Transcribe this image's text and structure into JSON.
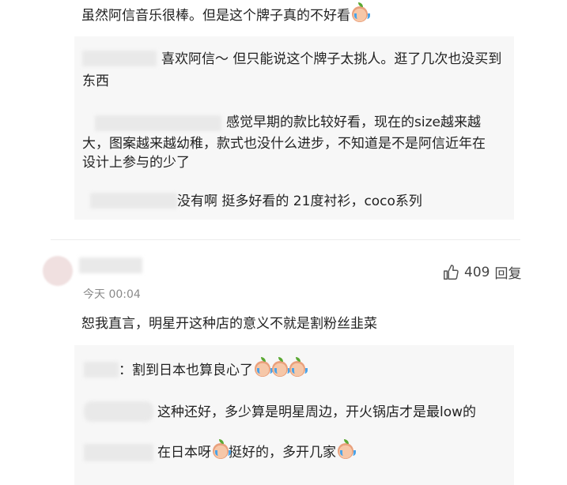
{
  "comment_1": {
    "text": "虽然阿信音乐很棒。但是这个牌子真的不好看",
    "emoji": "crying-emoji",
    "replies": [
      {
        "text_line1": "喜欢阿信～ 但只能说这个牌子太挑人。逛了几次也没买到",
        "text_line2": "东西"
      },
      {
        "text_line1": "感觉早期的款比较好看，现在的size越来越",
        "text_line2": "大，图案越来越幼稚，款式也没什么进步，不知道是不是阿信近年在",
        "text_line3": "设计上参与的少了"
      },
      {
        "text": "没有啊 挺多好看的 21度衬衫，coco系列"
      }
    ]
  },
  "comment_2": {
    "time": "今天 00:04",
    "like_count": "409",
    "reply_label": "回复",
    "text": "恕我直言，明星开这种店的意义不就是割粉丝韭菜",
    "replies": [
      {
        "text": "：割到日本也算良心了",
        "emoji_count": 3
      },
      {
        "text": "这种还好，多少算是明星周边，开火锅店才是最low的"
      },
      {
        "text_a": "在日本呀",
        "text_b": "挺好的，多开几家",
        "emoji_count": 2
      }
    ]
  },
  "colors": {
    "reply_bg": "#f7f7f7",
    "divider": "#ececec",
    "meta": "#8a8a8a"
  }
}
